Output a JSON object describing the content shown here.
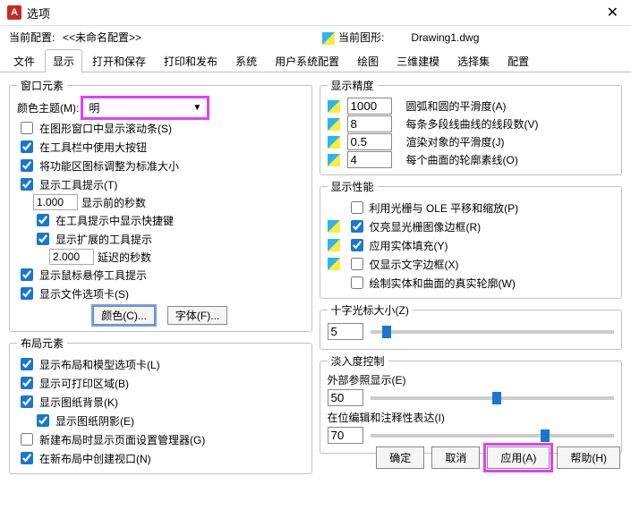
{
  "title": "选项",
  "profile_label": "当前配置:",
  "profile_value": "<<未命名配置>>",
  "drawing_label": "当前图形:",
  "drawing_value": "Drawing1.dwg",
  "tabs": [
    "文件",
    "显示",
    "打开和保存",
    "打印和发布",
    "系统",
    "用户系统配置",
    "绘图",
    "三维建模",
    "选择集",
    "配置"
  ],
  "winelem": {
    "legend": "窗口元素",
    "theme_label": "颜色主题(M):",
    "theme_value": "明",
    "cb_scroll": "在图形窗口中显示滚动条(S)",
    "cb_bigbtn": "在工具栏中使用大按钮",
    "cb_ribbon": "将功能区图标调整为标准大小",
    "cb_tooltip": "显示工具提示(T)",
    "sec_val": "1.000",
    "sec_lbl": "显示前的秒数",
    "cb_shortcut": "在工具提示中显示快捷键",
    "cb_ext": "显示扩展的工具提示",
    "delay_val": "2.000",
    "delay_lbl": "延迟的秒数",
    "cb_hover": "显示鼠标悬停工具提示",
    "cb_tabs": "显示文件选项卡(S)",
    "btn_color": "颜色(C)...",
    "btn_font": "字体(F)..."
  },
  "layout": {
    "legend": "布局元素",
    "cb1": "显示布局和模型选项卡(L)",
    "cb2": "显示可打印区域(B)",
    "cb3": "显示图纸背景(K)",
    "cb4": "显示图纸阴影(E)",
    "cb5": "新建布局时显示页面设置管理器(G)",
    "cb6": "在新布局中创建视口(N)"
  },
  "prec": {
    "legend": "显示精度",
    "r1_v": "1000",
    "r1_l": "圆弧和圆的平滑度(A)",
    "r2_v": "8",
    "r2_l": "每条多段线曲线的线段数(V)",
    "r3_v": "0.5",
    "r3_l": "渲染对象的平滑度(J)",
    "r4_v": "4",
    "r4_l": "每个曲面的轮廓素线(O)"
  },
  "perf": {
    "legend": "显示性能",
    "cb1": "利用光栅与 OLE 平移和缩放(P)",
    "cb2": "仅亮显光栅图像边框(R)",
    "cb3": "应用实体填充(Y)",
    "cb4": "仅显示文字边框(X)",
    "cb5": "绘制实体和曲面的真实轮廓(W)"
  },
  "cross": {
    "legend": "十字光标大小(Z)",
    "val": "5",
    "pct": 5
  },
  "fade": {
    "legend": "淡入度控制",
    "l1": "外部参照显示(E)",
    "v1": "50",
    "p1": 50,
    "l2": "在位编辑和注释性表达(I)",
    "v2": "70",
    "p2": 70
  },
  "footer": {
    "ok": "确定",
    "cancel": "取消",
    "apply": "应用(A)",
    "help": "帮助(H)"
  }
}
